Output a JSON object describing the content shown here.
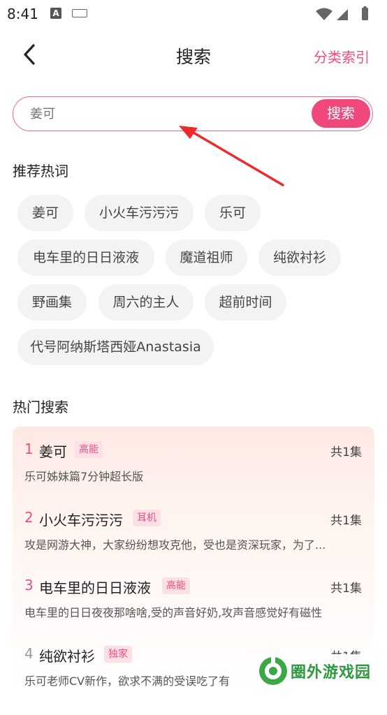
{
  "status": {
    "time": "8:41"
  },
  "header": {
    "title": "搜索",
    "category_link": "分类索引"
  },
  "search": {
    "placeholder": "姜可",
    "button_label": "搜索"
  },
  "recommend": {
    "title": "推荐热词",
    "keywords": [
      "姜可",
      "小火车污污污",
      "乐可",
      "电车里的日日液液",
      "魔道祖师",
      "纯欲衬衫",
      "野画集",
      "周六的主人",
      "超前时间",
      "代号阿纳斯塔西娅Anastasia"
    ]
  },
  "hot": {
    "title": "热门搜索",
    "items": [
      {
        "rank": "1",
        "title": "姜可",
        "tag": "高能",
        "count": "共1集",
        "desc": "乐可姊妹篇7分钟超长版"
      },
      {
        "rank": "2",
        "title": "小火车污污污",
        "tag": "耳机",
        "count": "共1集",
        "desc": "攻是网游大神，大家纷纷想攻克他，受也是资深玩家，为了..."
      },
      {
        "rank": "3",
        "title": "电车里的日日液液",
        "tag": "高能",
        "count": "共1集",
        "desc": "电车里的日日夜夜那啥啥,受的声音好奶,攻声音感觉好有磁性"
      },
      {
        "rank": "4",
        "title": "纯欲衬衫",
        "tag": "独家",
        "count": "共1集",
        "desc": "乐可老师CV新作，欲求不满的受误吃了有"
      }
    ],
    "rank_colors": {
      "top": "#ef4f7f",
      "normal": "#999999"
    }
  },
  "watermark": {
    "text": "圈外游戏园"
  },
  "colors": {
    "accent": "#f0487a",
    "chip_bg": "#f3f3f3"
  }
}
